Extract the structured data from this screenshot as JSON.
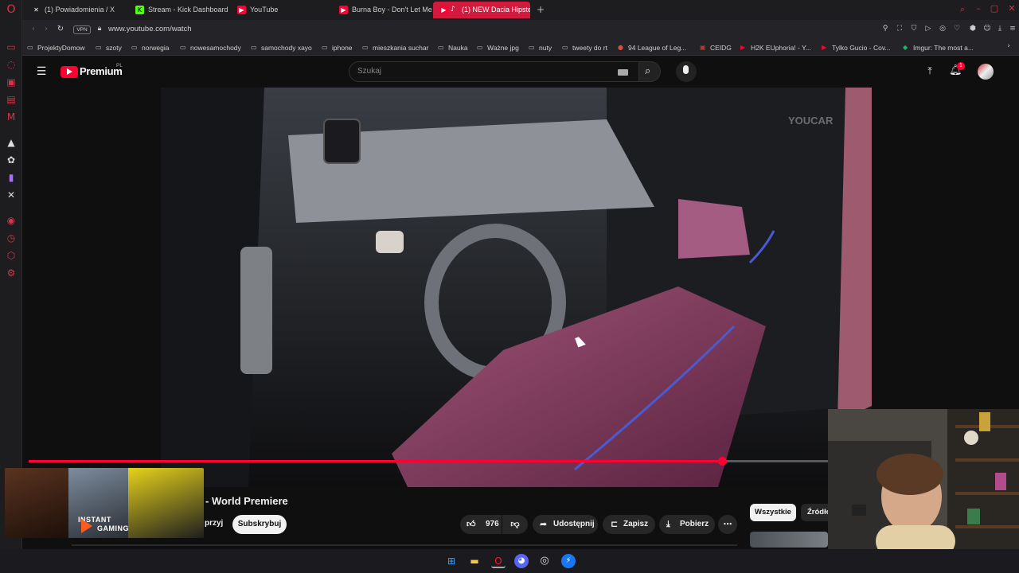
{
  "browser": {
    "tabs": [
      {
        "label": "(1) Powiadomienia / X",
        "icon": "x-logo-icon"
      },
      {
        "label": "Stream - Kick Dashboard",
        "icon": "kick-logo-icon"
      },
      {
        "label": "YouTube",
        "icon": "youtube-logo-icon"
      },
      {
        "label": "Burna Boy - Don't Let Me",
        "icon": "youtube-logo-icon"
      },
      {
        "label": "(1) NEW Dacia Hipste",
        "icon": "youtube-logo-icon"
      }
    ],
    "vpn_label": "VPN",
    "url": "www.youtube.com/watch",
    "bookmarks": [
      "ProjektyDomow",
      "szoty",
      "norwegia",
      "nowesamochody",
      "samochody xayo",
      "iphone",
      "mieszkania suchar",
      "Nauka",
      "Ważne jpg",
      "nuty",
      "tweety do rt",
      "94 League of Leg...",
      "CEIDG",
      "H2K EUphoria! - Y...",
      "Tylko Gucio - Cov...",
      "Imgur: The most a..."
    ]
  },
  "youtube": {
    "logo_text": "Premium",
    "logo_sup": "PL",
    "search_placeholder": "Szukaj",
    "notification_count": "1",
    "video_watermark": "YOUCAR",
    "progress_fraction": 0.868,
    "title_partial": "- World Premiere",
    "channel_partial": "przyj",
    "subscribe_label": "Subskrybuj",
    "like_count": "976",
    "share_label": "Udostępnij",
    "save_label": "Zapisz",
    "download_label": "Pobierz",
    "filter_all": "Wszystkie",
    "filter_source": "Źródło",
    "ad_text_line1": "INSTANT",
    "ad_text_line2": "GAMING"
  },
  "colors": {
    "accent_red": "#d11a3d",
    "youtube_red": "#ff0033"
  }
}
